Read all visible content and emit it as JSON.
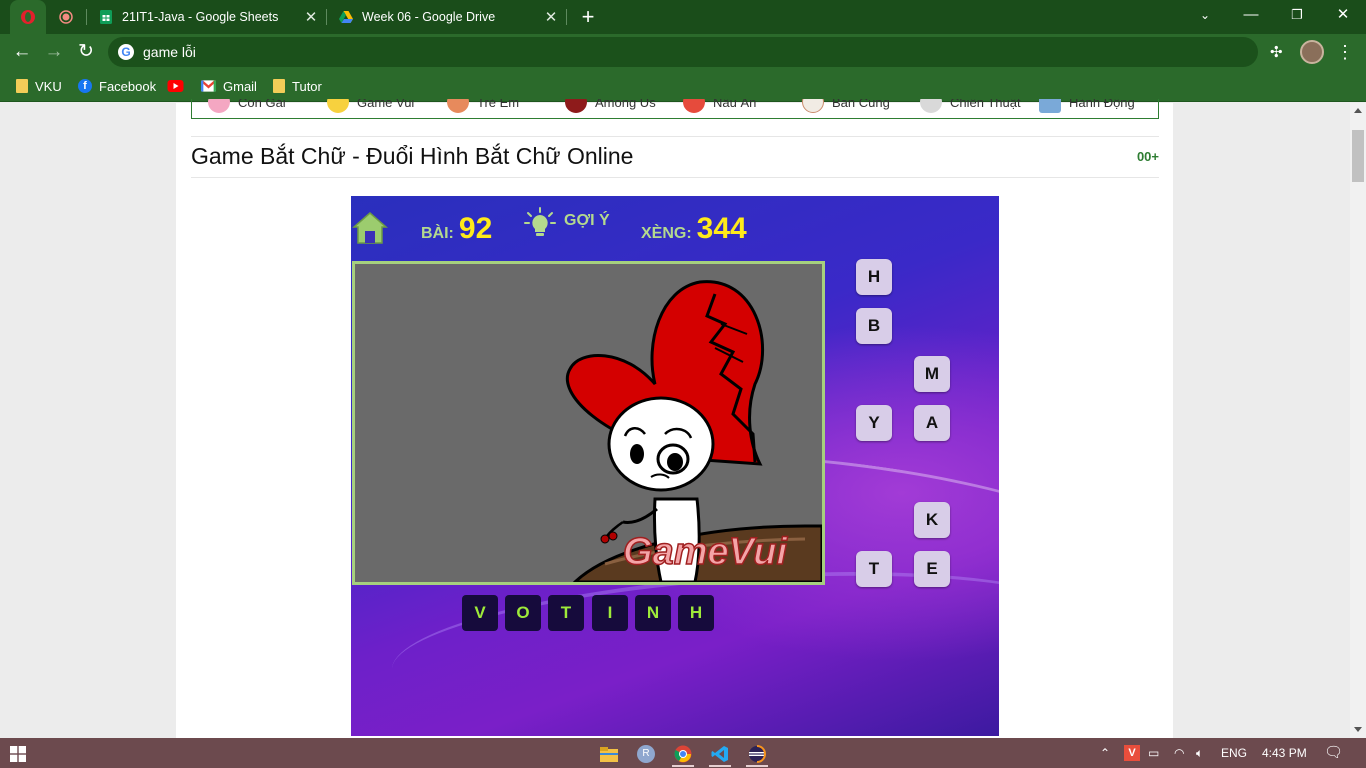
{
  "browser": {
    "tabs": [
      {
        "title": "21IT1-Java - Google Sheets",
        "icon": "google-sheets-icon"
      },
      {
        "title": "Week 06 - Google Drive",
        "icon": "google-drive-icon"
      }
    ],
    "address": "game lỗi",
    "bookmarks": [
      {
        "label": "VKU",
        "icon": "folder-icon"
      },
      {
        "label": "Facebook",
        "icon": "facebook-icon"
      },
      {
        "label": "",
        "icon": "youtube-icon"
      },
      {
        "label": "Gmail",
        "icon": "gmail-icon"
      },
      {
        "label": "Tutor",
        "icon": "folder-icon"
      }
    ]
  },
  "site": {
    "categories": [
      "Con Gái",
      "Game Vui",
      "Trẻ Em",
      "Among Us",
      "Nấu Ăn",
      "Bắn Cung",
      "Chiến Thuật",
      "Hành Động"
    ],
    "title": "Game Bắt Chữ - Đuổi Hình Bắt Chữ Online",
    "plays": "00+"
  },
  "game": {
    "level_label": "BÀI:",
    "level": "92",
    "hint_label": "GỢI Ý",
    "coins_label": "XÈNG:",
    "coins": "344",
    "choices": [
      "H",
      "B",
      "M",
      "Y",
      "A",
      "K",
      "T",
      "E"
    ],
    "answer": [
      "V",
      "O",
      "T",
      "I",
      "N",
      "H"
    ],
    "watermark": "GameVui"
  },
  "taskbar": {
    "apps": [
      "file-explorer-icon",
      "r-icon",
      "chrome-icon",
      "vscode-icon",
      "eclipse-icon"
    ],
    "language": "ENG",
    "time": "4:43 PM"
  },
  "colors": {
    "chrome_green": "#2b6a2b",
    "hud_yellow": "#ffea1a",
    "hud_green": "#b4d98e",
    "answer_text": "#9eea3a"
  }
}
